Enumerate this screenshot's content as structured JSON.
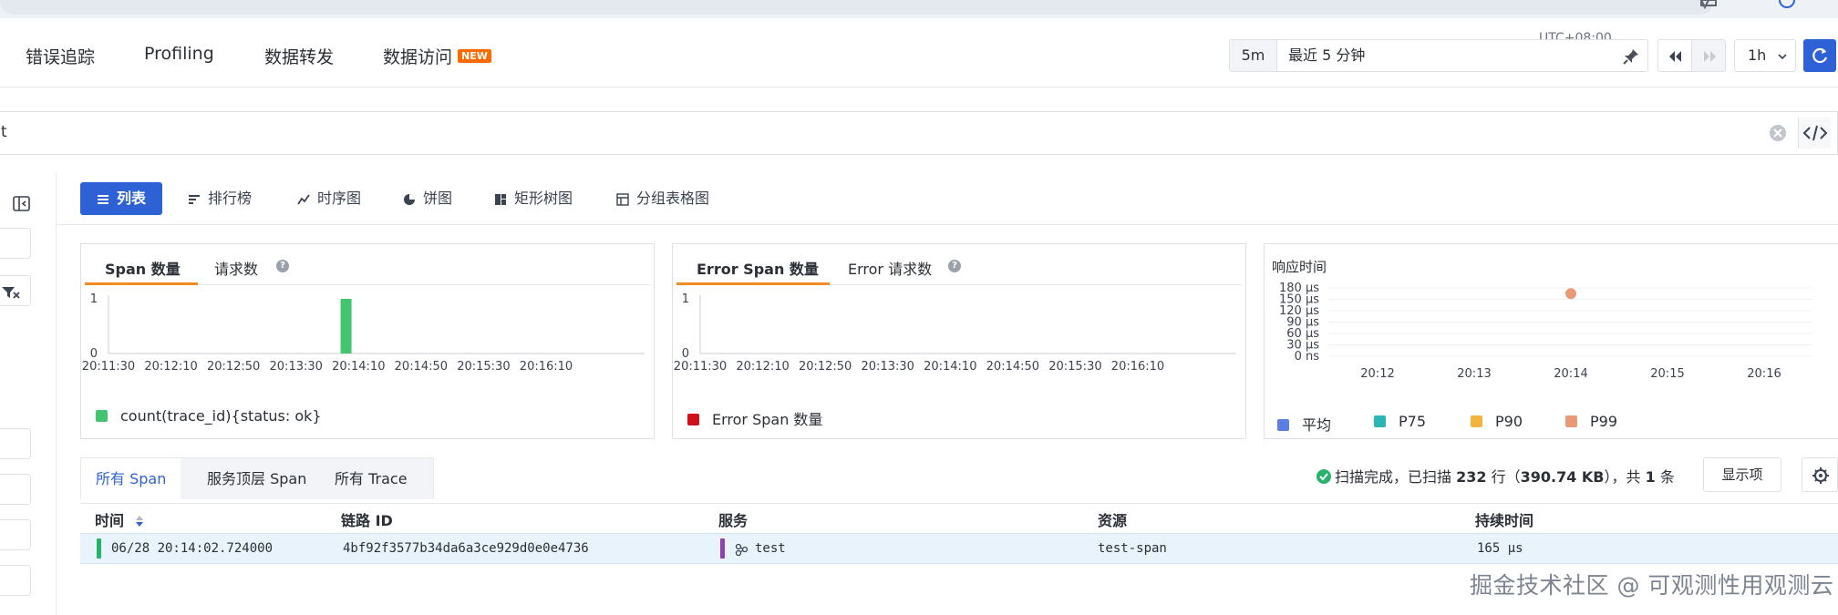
{
  "nav": {
    "items": [
      "错误追踪",
      "Profiling",
      "数据转发",
      "数据访问"
    ],
    "new_badge": "NEW",
    "timezone": "UTC+08:00",
    "time_shortcut": "5m",
    "time_label": "最近 5 分钟",
    "interval": "1h"
  },
  "query": {
    "text": "t"
  },
  "view_tabs": [
    "列表",
    "排行榜",
    "时序图",
    "饼图",
    "矩形树图",
    "分组表格图"
  ],
  "colors": {
    "accent": "#2f61d6",
    "ok_green": "#45c46f",
    "error_red": "#d0111b",
    "orange": "#f28b24"
  },
  "cards": {
    "span": {
      "tab_active": "Span 数量",
      "tab_other": "请求数",
      "help": "?"
    },
    "error": {
      "tab_active": "Error Span 数量",
      "tab_other": "Error 请求数",
      "help": "?"
    },
    "response": {
      "title": "响应时间"
    }
  },
  "chart_data": [
    {
      "type": "bar",
      "x_ticks": [
        "20:11:30",
        "20:12:10",
        "20:12:50",
        "20:13:30",
        "20:14:10",
        "20:14:50",
        "20:15:30",
        "20:16:10"
      ],
      "y_ticks": [
        "1",
        "0"
      ],
      "ylim": [
        0,
        1
      ],
      "series": [
        {
          "name": "count(trace_id){status: ok}",
          "color": "#45c46f",
          "points": [
            {
              "x": "20:14:02",
              "y": 1
            }
          ]
        }
      ],
      "legend": "bottom-left"
    },
    {
      "type": "bar",
      "x_ticks": [
        "20:11:30",
        "20:12:10",
        "20:12:50",
        "20:13:30",
        "20:14:10",
        "20:14:50",
        "20:15:30",
        "20:16:10"
      ],
      "y_ticks": [
        "1",
        "0"
      ],
      "ylim": [
        0,
        1
      ],
      "series": [
        {
          "name": "Error Span 数量",
          "color": "#d0111b",
          "points": []
        }
      ],
      "legend": "bottom-left"
    },
    {
      "type": "scatter",
      "x_ticks": [
        "20:12",
        "20:13",
        "20:14",
        "20:15",
        "20:16"
      ],
      "y_ticks": [
        "180 μs",
        "150 μs",
        "120 μs",
        "90 μs",
        "60 μs",
        "30 μs",
        "0 ns"
      ],
      "ylim": [
        0,
        180
      ],
      "grid": true,
      "series": [
        {
          "name": "平均",
          "color": "#5b7fe0",
          "points": []
        },
        {
          "name": "P75",
          "color": "#2bb5b5",
          "points": []
        },
        {
          "name": "P90",
          "color": "#f2b440",
          "points": []
        },
        {
          "name": "P99",
          "color": "#e89a76",
          "points": [
            {
              "x": "20:14",
              "y": 165
            }
          ]
        }
      ],
      "legend": "bottom-left"
    }
  ],
  "list_tabs": [
    "所有 Span",
    "服务顶层 Span",
    "所有 Trace"
  ],
  "scan": {
    "prefix": "扫描完成，已扫描 ",
    "rows": "232",
    "mid": " 行（",
    "size": "390.74 KB",
    "mid2": "），共 ",
    "count": "1",
    "suffix": " 条"
  },
  "display_button": "显示项",
  "table": {
    "columns": [
      "时间",
      "链路 ID",
      "服务",
      "资源",
      "持续时间"
    ],
    "rows": [
      {
        "time": "06/28 20:14:02.724000",
        "trace_id": "4bf92f3577b34da6a3ce929d0e0e4736",
        "service": "test",
        "resource": "test-span",
        "duration": "165 μs"
      }
    ]
  },
  "watermark": "掘金技术社区 @ 可观测性用观测云"
}
